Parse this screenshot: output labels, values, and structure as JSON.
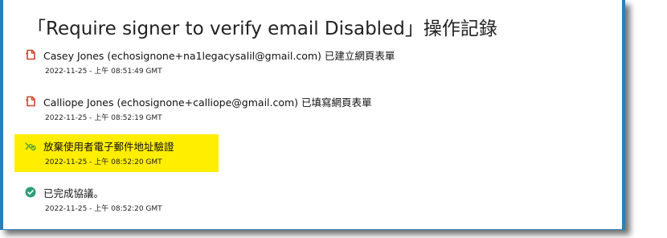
{
  "title": "「Require signer to verify email Disabled」操作記錄",
  "colors": {
    "frame": "#2b7fb8",
    "highlight": "#ffee00",
    "document_icon": "#d1452f",
    "check_icon": "#2e9e78",
    "disabled_icon": "#5aa52f"
  },
  "entries": [
    {
      "icon": "document-icon",
      "text": "Casey Jones (echosignone+na1legacysalil@gmail.com) 已建立網頁表單",
      "time": "2022-11-25 - 上午 08:51:49 GMT"
    },
    {
      "icon": "document-icon",
      "text": "Calliope Jones (echosignone+calliope@gmail.com) 已填寫網頁表單",
      "time": "2022-11-25 - 上午 08:52:19 GMT"
    },
    {
      "icon": "verification-disabled-icon",
      "text": "放棄使用者電子郵件地址驗證",
      "time": "2022-11-25 - 上午 08:52:20 GMT",
      "highlighted": true
    },
    {
      "icon": "check-circle-icon",
      "text": "已完成協議。",
      "time": "2022-11-25 - 上午 08:52:20 GMT"
    }
  ]
}
